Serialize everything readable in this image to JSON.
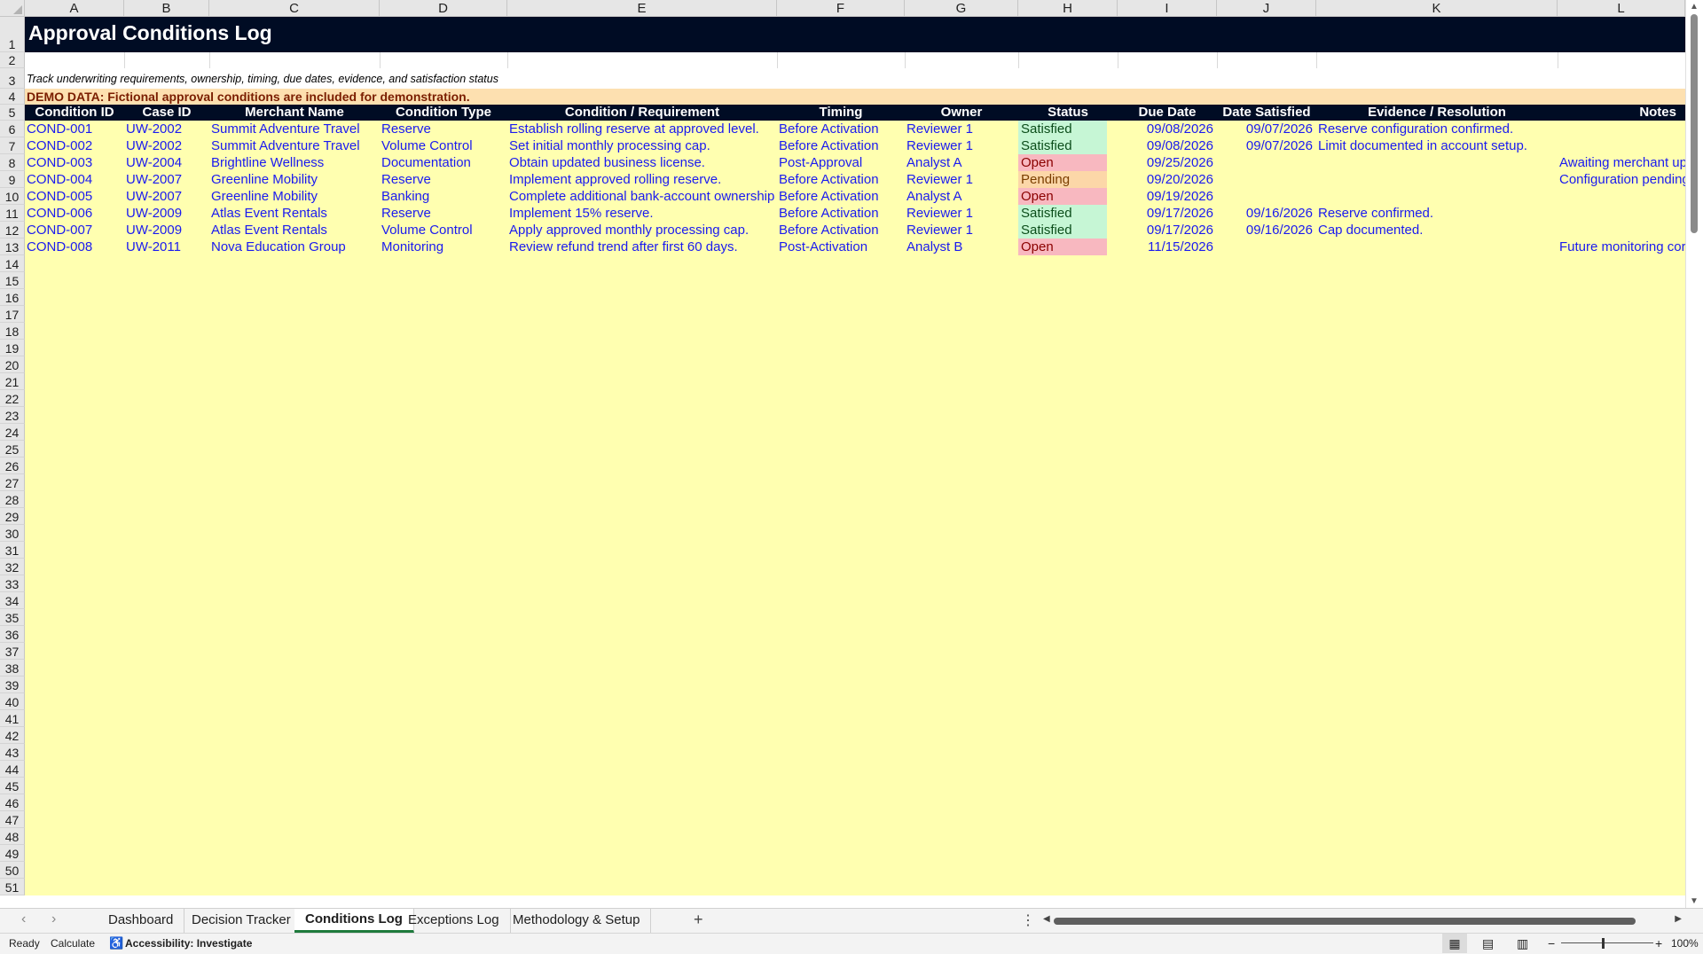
{
  "columns": [
    "A",
    "B",
    "C",
    "D",
    "E",
    "F",
    "G",
    "H",
    "I",
    "J",
    "K",
    "L"
  ],
  "title": "Approval Conditions Log",
  "subtitle": "Track underwriting requirements, ownership, timing, due dates, evidence, and satisfaction status",
  "demo_note": "DEMO DATA: Fictional approval conditions are included for demonstration.",
  "headers": [
    "Condition ID",
    "Case ID",
    "Merchant Name",
    "Condition Type",
    "Condition / Requirement",
    "Timing",
    "Owner",
    "Status",
    "Due Date",
    "Date Satisfied",
    "Evidence / Resolution",
    "Notes"
  ],
  "rows": [
    [
      "COND-001",
      "UW-2002",
      "Summit Adventure Travel",
      "Reserve",
      "Establish rolling reserve at approved level.",
      "Before Activation",
      "Reviewer 1",
      "Satisfied",
      "09/08/2026",
      "09/07/2026",
      "Reserve configuration confirmed.",
      ""
    ],
    [
      "COND-002",
      "UW-2002",
      "Summit Adventure Travel",
      "Volume Control",
      "Set initial monthly processing cap.",
      "Before Activation",
      "Reviewer 1",
      "Satisfied",
      "09/08/2026",
      "09/07/2026",
      "Limit documented in account setup.",
      ""
    ],
    [
      "COND-003",
      "UW-2004",
      "Brightline Wellness",
      "Documentation",
      "Obtain updated business license.",
      "Post-Approval",
      "Analyst A",
      "Open",
      "09/25/2026",
      "",
      "",
      "Awaiting merchant up"
    ],
    [
      "COND-004",
      "UW-2007",
      "Greenline Mobility",
      "Reserve",
      "Implement approved rolling reserve.",
      "Before Activation",
      "Reviewer 1",
      "Pending",
      "09/20/2026",
      "",
      "",
      "Configuration pending"
    ],
    [
      "COND-005",
      "UW-2007",
      "Greenline Mobility",
      "Banking",
      "Complete additional bank-account ownership v",
      "Before Activation",
      "Analyst A",
      "Open",
      "09/19/2026",
      "",
      "",
      ""
    ],
    [
      "COND-006",
      "UW-2009",
      "Atlas Event Rentals",
      "Reserve",
      "Implement 15% reserve.",
      "Before Activation",
      "Reviewer 1",
      "Satisfied",
      "09/17/2026",
      "09/16/2026",
      "Reserve confirmed.",
      ""
    ],
    [
      "COND-007",
      "UW-2009",
      "Atlas Event Rentals",
      "Volume Control",
      "Apply approved monthly processing cap.",
      "Before Activation",
      "Reviewer 1",
      "Satisfied",
      "09/17/2026",
      "09/16/2026",
      "Cap documented.",
      ""
    ],
    [
      "COND-008",
      "UW-2011",
      "Nova Education Group",
      "Monitoring",
      "Review refund trend after first 60 days.",
      "Post-Activation",
      "Analyst B",
      "Open",
      "11/15/2026",
      "",
      "",
      "Future monitoring cor"
    ]
  ],
  "status_colors": {
    "Satisfied": "#c6f6d5",
    "Open": "#f8b8c0",
    "Pending": "#fcd7a8"
  },
  "status_text_colors": {
    "Satisfied": "#0b4d1a",
    "Open": "#8b0000",
    "Pending": "#7a3e00"
  },
  "colors": {
    "title_bg": "#000c24",
    "header_bg": "#000c24",
    "demo_bg": "#fde0b0",
    "demo_text": "#7a1d00",
    "body_bg": "#ffffb0",
    "data_text": "#1a1af0",
    "tab_accent": "#1e7a3c"
  },
  "row_numbers": [
    "1",
    "2",
    "3",
    "4",
    "5",
    "6",
    "7",
    "8",
    "9",
    "10",
    "11",
    "12",
    "13",
    "14",
    "15",
    "16",
    "17",
    "18",
    "19",
    "20",
    "21",
    "22",
    "23",
    "24",
    "25",
    "26",
    "27",
    "28",
    "29",
    "30",
    "31",
    "32",
    "33",
    "34",
    "35",
    "36",
    "37",
    "38",
    "39",
    "40",
    "41",
    "42",
    "43",
    "44",
    "45",
    "46",
    "47",
    "48",
    "49",
    "50",
    "51"
  ],
  "sheet_tabs": [
    "Dashboard",
    "Decision Tracker",
    "Conditions Log",
    "Exceptions Log",
    "Methodology & Setup"
  ],
  "active_tab": "Conditions Log",
  "status": {
    "ready": "Ready",
    "calculate": "Calculate",
    "accessibility": "Accessibility: Investigate",
    "zoom": "100%"
  },
  "icons": [
    "prev-sheet-icon",
    "next-sheet-icon",
    "add-sheet-icon",
    "more-options-icon",
    "normal-view-icon",
    "page-layout-icon",
    "page-break-icon",
    "zoom-out-icon",
    "zoom-in-icon",
    "accessibility-icon"
  ]
}
